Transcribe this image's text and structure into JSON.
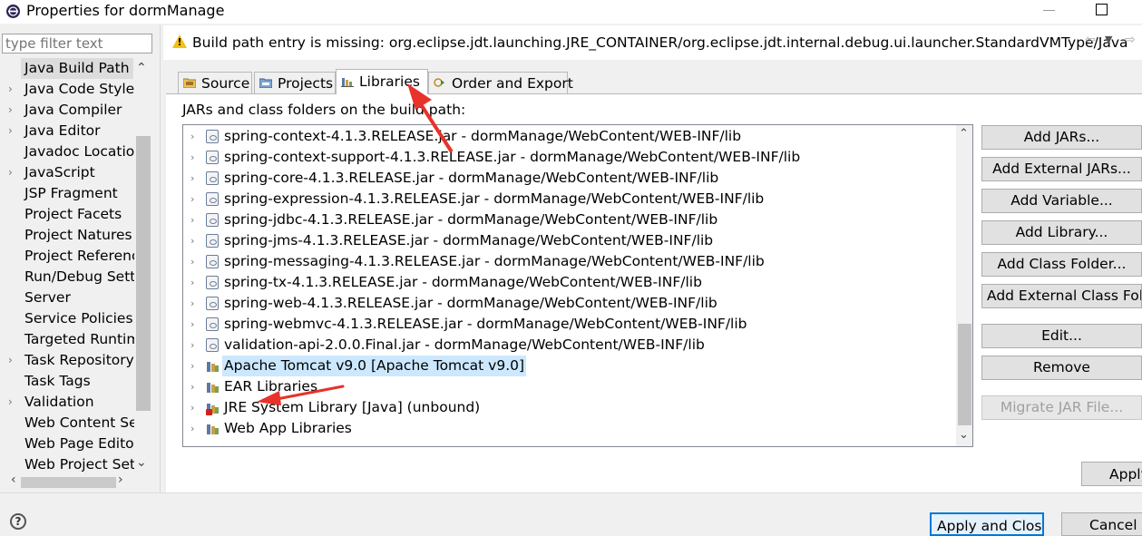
{
  "window": {
    "title": "Properties for dormManage"
  },
  "filter": {
    "placeholder": "type filter text"
  },
  "nav": {
    "items": [
      {
        "label": "Java Build Path",
        "expandable": false,
        "selected": true
      },
      {
        "label": "Java Code Style",
        "expandable": true
      },
      {
        "label": "Java Compiler",
        "expandable": true
      },
      {
        "label": "Java Editor",
        "expandable": true
      },
      {
        "label": "Javadoc Location",
        "expandable": false
      },
      {
        "label": "JavaScript",
        "expandable": true
      },
      {
        "label": "JSP Fragment",
        "expandable": false
      },
      {
        "label": "Project Facets",
        "expandable": false
      },
      {
        "label": "Project Natures",
        "expandable": false
      },
      {
        "label": "Project References",
        "expandable": false
      },
      {
        "label": "Run/Debug Settings",
        "expandable": false
      },
      {
        "label": "Server",
        "expandable": false
      },
      {
        "label": "Service Policies",
        "expandable": false
      },
      {
        "label": "Targeted Runtimes",
        "expandable": false
      },
      {
        "label": "Task Repository",
        "expandable": true
      },
      {
        "label": "Task Tags",
        "expandable": false
      },
      {
        "label": "Validation",
        "expandable": true
      },
      {
        "label": "Web Content Settings",
        "expandable": false
      },
      {
        "label": "Web Page Editor",
        "expandable": false
      },
      {
        "label": "Web Project Settings",
        "expandable": false
      }
    ]
  },
  "message": {
    "icon": "warning-icon",
    "text": "Build path entry is missing: org.eclipse.jdt.launching.JRE_CONTAINER/org.eclipse.jdt.internal.debug.ui.launcher.StandardVMType/Java"
  },
  "tabs": [
    {
      "label": "Source",
      "icon": "source-folder-icon"
    },
    {
      "label": "Projects",
      "icon": "projects-icon"
    },
    {
      "label": "Libraries",
      "icon": "libraries-icon",
      "active": true
    },
    {
      "label": "Order and Export",
      "icon": "order-export-icon"
    }
  ],
  "libraries": {
    "caption": "JARs and class folders on the build path:",
    "entries": [
      {
        "label": "spring-context-4.1.3.RELEASE.jar - dormManage/WebContent/WEB-INF/lib",
        "kind": "jar"
      },
      {
        "label": "spring-context-support-4.1.3.RELEASE.jar - dormManage/WebContent/WEB-INF/lib",
        "kind": "jar"
      },
      {
        "label": "spring-core-4.1.3.RELEASE.jar - dormManage/WebContent/WEB-INF/lib",
        "kind": "jar"
      },
      {
        "label": "spring-expression-4.1.3.RELEASE.jar - dormManage/WebContent/WEB-INF/lib",
        "kind": "jar"
      },
      {
        "label": "spring-jdbc-4.1.3.RELEASE.jar - dormManage/WebContent/WEB-INF/lib",
        "kind": "jar"
      },
      {
        "label": "spring-jms-4.1.3.RELEASE.jar - dormManage/WebContent/WEB-INF/lib",
        "kind": "jar"
      },
      {
        "label": "spring-messaging-4.1.3.RELEASE.jar - dormManage/WebContent/WEB-INF/lib",
        "kind": "jar"
      },
      {
        "label": "spring-tx-4.1.3.RELEASE.jar - dormManage/WebContent/WEB-INF/lib",
        "kind": "jar"
      },
      {
        "label": "spring-web-4.1.3.RELEASE.jar - dormManage/WebContent/WEB-INF/lib",
        "kind": "jar"
      },
      {
        "label": "spring-webmvc-4.1.3.RELEASE.jar - dormManage/WebContent/WEB-INF/lib",
        "kind": "jar"
      },
      {
        "label": "validation-api-2.0.0.Final.jar - dormManage/WebContent/WEB-INF/lib",
        "kind": "jar"
      },
      {
        "label": "Apache Tomcat v9.0 [Apache Tomcat v9.0]",
        "kind": "library",
        "selected": true
      },
      {
        "label": "EAR Libraries",
        "kind": "library"
      },
      {
        "label": "JRE System Library [Java] (unbound)",
        "kind": "library-error"
      },
      {
        "label": "Web App Libraries",
        "kind": "library"
      }
    ]
  },
  "buttons": {
    "add_jars": "Add JARs...",
    "add_external_jars": "Add External JARs...",
    "add_variable": "Add Variable...",
    "add_library": "Add Library...",
    "add_class_folder": "Add Class Folder...",
    "add_external_class_folder": "Add External Class Folder...",
    "edit": "Edit...",
    "remove": "Remove",
    "migrate_jar": "Migrate JAR File...",
    "apply": "Apply",
    "apply_and_close": "Apply and Close",
    "cancel": "Cancel"
  },
  "help": {
    "icon": "help-icon",
    "glyph": "?"
  },
  "annotations": {
    "arrow_color": "#e8322a"
  },
  "colors": {
    "selection": "#cce8ff",
    "warning": "#f2c010"
  }
}
